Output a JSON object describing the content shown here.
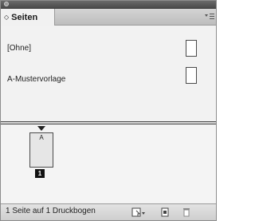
{
  "panel": {
    "tab_label": "Seiten",
    "tab_arrows": "◇"
  },
  "masters": [
    {
      "label": "[Ohne]"
    },
    {
      "label": "A-Mustervorlage"
    }
  ],
  "pages": {
    "thumb_prefix": "A",
    "page_number": "1"
  },
  "status": {
    "text": "1 Seite auf 1 Druckbogen"
  },
  "icons": {
    "panel_menu": "panel-menu-icon",
    "edit_page_size": "edit-page-size-icon",
    "new_page": "new-page-icon",
    "delete_page": "trash-icon"
  }
}
